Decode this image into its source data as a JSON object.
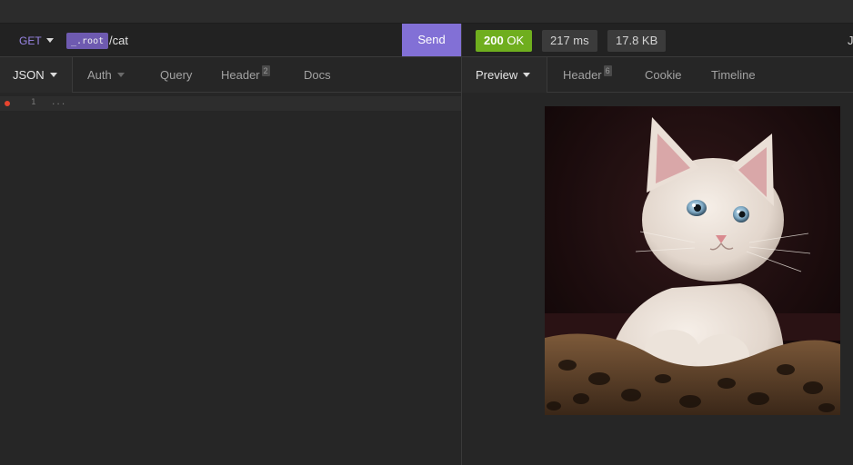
{
  "request": {
    "method": "GET",
    "env_tag": "_.root",
    "path": "/cat",
    "send_label": "Send"
  },
  "response": {
    "status_code": "200",
    "status_text": "OK",
    "time": "217 ms",
    "size": "17.8 KB",
    "extra": "Ju"
  },
  "request_tabs": [
    {
      "label": "JSON",
      "active": true
    },
    {
      "label": "Auth"
    },
    {
      "label": "Query"
    },
    {
      "label": "Header",
      "count": "2"
    },
    {
      "label": "Docs"
    }
  ],
  "response_tabs": [
    {
      "label": "Preview",
      "active": true
    },
    {
      "label": "Header",
      "count": "6"
    },
    {
      "label": "Cookie"
    },
    {
      "label": "Timeline"
    }
  ],
  "editor": {
    "line_number": "1",
    "line_text": "..."
  },
  "preview": {
    "image_icon": "cat-image"
  },
  "colors": {
    "accent": "#8270d6",
    "method": "#9a86e6",
    "env_tag": "#6e5ab0",
    "status_ok": "#6fae1e",
    "error_dot": "#e8442e",
    "background": "#262626"
  }
}
